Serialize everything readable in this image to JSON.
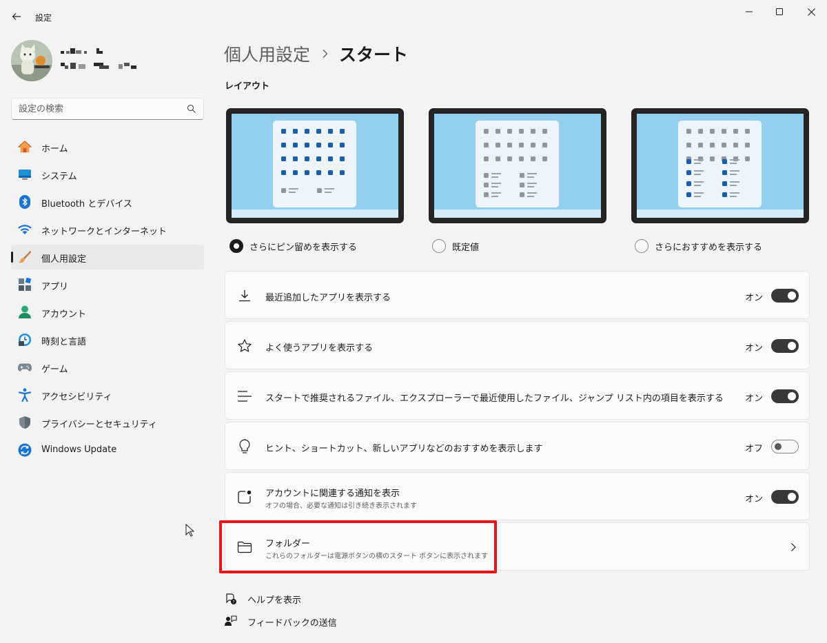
{
  "window": {
    "title": "設定",
    "controls": [
      "minimize-icon",
      "maximize-icon",
      "close-icon"
    ]
  },
  "search": {
    "placeholder": "設定の検索"
  },
  "sidebar": {
    "items": [
      {
        "label": "ホーム",
        "icon": "home-icon",
        "selected": false
      },
      {
        "label": "システム",
        "icon": "system-icon",
        "selected": false
      },
      {
        "label": "Bluetooth とデバイス",
        "icon": "bluetooth-icon",
        "selected": false
      },
      {
        "label": "ネットワークとインターネット",
        "icon": "wifi-icon",
        "selected": false
      },
      {
        "label": "個人用設定",
        "icon": "brush-icon",
        "selected": true
      },
      {
        "label": "アプリ",
        "icon": "apps-icon",
        "selected": false
      },
      {
        "label": "アカウント",
        "icon": "account-icon",
        "selected": false
      },
      {
        "label": "時刻と言語",
        "icon": "time-language-icon",
        "selected": false
      },
      {
        "label": "ゲーム",
        "icon": "gamepad-icon",
        "selected": false
      },
      {
        "label": "アクセシビリティ",
        "icon": "accessibility-icon",
        "selected": false
      },
      {
        "label": "プライバシーとセキュリティ",
        "icon": "shield-icon",
        "selected": false
      },
      {
        "label": "Windows Update",
        "icon": "windows-update-icon",
        "selected": false
      }
    ]
  },
  "header": {
    "parent": "個人用設定",
    "current": "スタート"
  },
  "layout": {
    "title": "レイアウト",
    "options": [
      {
        "label": "さらにピン留めを表示する",
        "checked": true
      },
      {
        "label": "既定値",
        "checked": false
      },
      {
        "label": "さらにおすすめを表示する",
        "checked": false
      }
    ]
  },
  "settings": [
    {
      "title": "最近追加したアプリを表示する",
      "subtitle": "",
      "state": "オン",
      "on": true,
      "icon": "download-icon"
    },
    {
      "title": "よく使うアプリを表示する",
      "subtitle": "",
      "state": "オン",
      "on": true,
      "icon": "star-icon"
    },
    {
      "title": "スタートで推奨されるファイル、エクスプローラーで最近使用したファイル、ジャンプ リスト内の項目を表示する",
      "subtitle": "",
      "state": "オン",
      "on": true,
      "icon": "list-icon"
    },
    {
      "title": "ヒント、ショートカット、新しいアプリなどのおすすめを表示します",
      "subtitle": "",
      "state": "オフ",
      "on": false,
      "icon": "lightbulb-icon"
    },
    {
      "title": "アカウントに関連する通知を表示",
      "subtitle": "オフの場合、必要な通知は引き続き表示されます",
      "state": "オン",
      "on": true,
      "icon": "notification-icon"
    }
  ],
  "folders": {
    "title": "フォルダー",
    "subtitle": "これらのフォルダーは電源ボタンの横のスタート ボタンに表示されます",
    "icon": "folder-icon"
  },
  "footer": {
    "help": "ヘルプを表示",
    "feedback": "フィードバックの送信"
  },
  "colors": {
    "accent_dark": "#383838",
    "highlight": "#e8141a",
    "layout_screen": "#93cfee",
    "layout_blue_dot": "#1a5ea8"
  }
}
